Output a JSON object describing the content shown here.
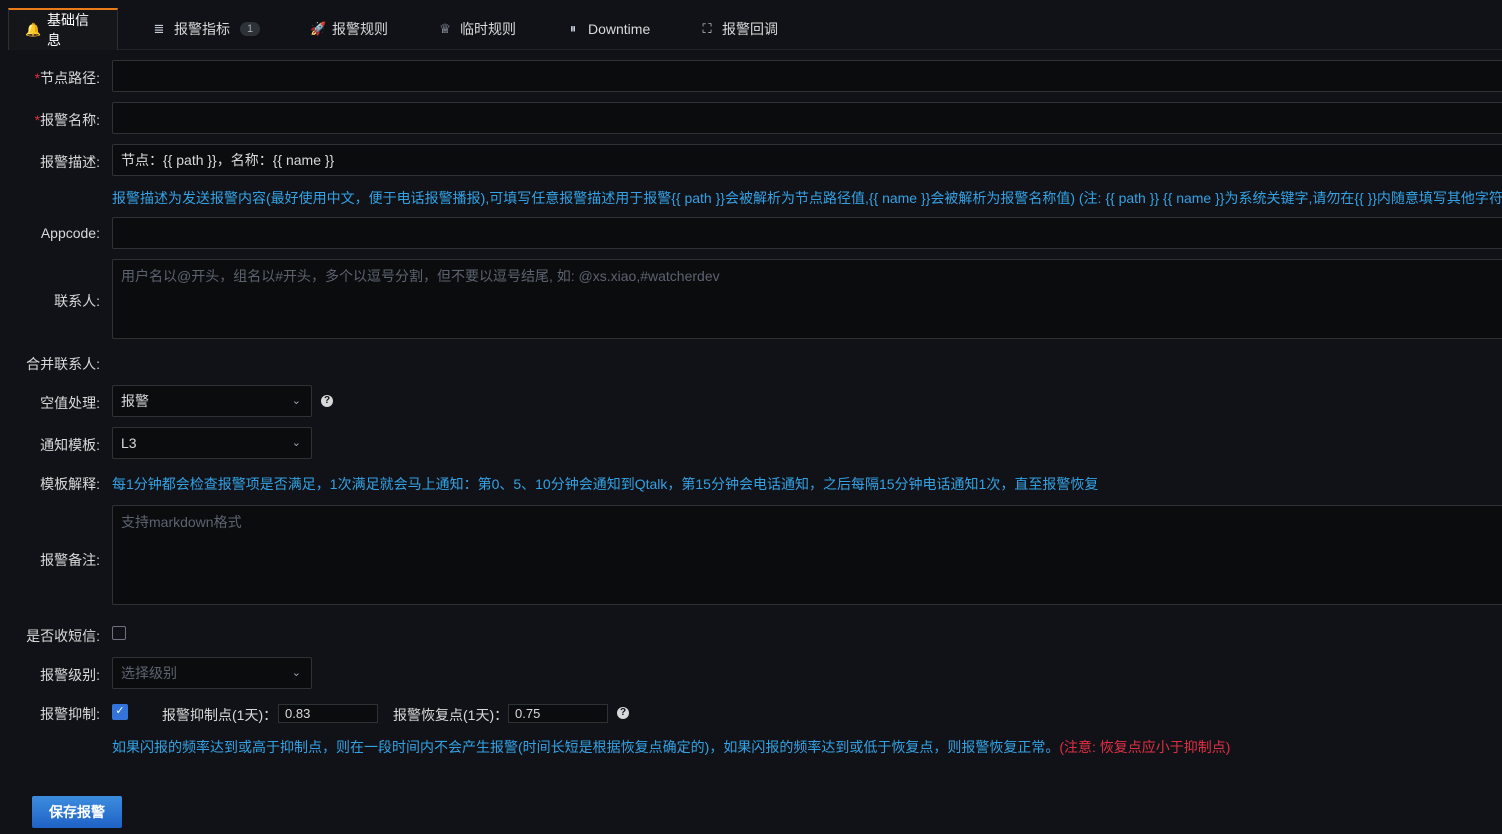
{
  "tabs": [
    {
      "label": "基础信息",
      "icon": "bell-icon",
      "glyph": "🔔"
    },
    {
      "label": "报警指标",
      "icon": "database-icon",
      "glyph": "≣",
      "badge": "1"
    },
    {
      "label": "报警规则",
      "icon": "rocket-icon",
      "glyph": "🚀"
    },
    {
      "label": "临时规则",
      "icon": "bulb-icon",
      "glyph": "♕"
    },
    {
      "label": "Downtime",
      "icon": "pause-icon",
      "glyph": "⏸"
    },
    {
      "label": "报警回调",
      "icon": "expand-icon",
      "glyph": "⛶"
    }
  ],
  "form": {
    "required_mark": "*",
    "node_path": {
      "label": "节点路径:",
      "value": ""
    },
    "alert_name": {
      "label": "报警名称:",
      "value": ""
    },
    "alert_desc": {
      "label": "报警描述:",
      "value": "节点：{{ path }}，名称：{{ name }}"
    },
    "desc_hint": "报警描述为发送报警内容(最好使用中文，便于电话报警播报),可填写任意报警描述用于报警{{ path }}会被解析为节点路径值,{{ name }}会被解析为报警名称值) (注: {{ path }} {{ name }}为系统关键字,请勿在{{ }}内随意填写其他字符)",
    "appcode": {
      "label": "Appcode:",
      "value": ""
    },
    "contacts": {
      "label": "联系人:",
      "placeholder": "用户名以@开头，组名以#开头，多个以逗号分割，但不要以逗号结尾, 如: @xs.xiao,#watcherdev"
    },
    "merge_contacts": {
      "label": "合并联系人:"
    },
    "null_handling": {
      "label": "空值处理:",
      "value": "报警"
    },
    "notify_template": {
      "label": "通知模板:",
      "value": "L3"
    },
    "template_explain": {
      "label": "模板解释:",
      "text": "每1分钟都会检查报警项是否满足，1次满足就会马上通知：第0、5、10分钟会通知到Qtalk，第15分钟会电话通知，之后每隔15分钟电话通知1次，直至报警恢复"
    },
    "alert_note": {
      "label": "报警备注:",
      "placeholder": "支持markdown格式"
    },
    "sms": {
      "label": "是否收短信:",
      "checked": false
    },
    "alert_level": {
      "label": "报警级别:",
      "placeholder": "选择级别"
    },
    "suppress": {
      "label": "报警抑制:",
      "checked": true,
      "suppress_point_label": "报警抑制点(1天)：",
      "suppress_point_value": "0.83",
      "recover_point_label": "报警恢复点(1天)：",
      "recover_point_value": "0.75",
      "hint": "如果闪报的频率达到或高于抑制点，则在一段时间内不会产生报警(时间长短是根据恢复点确定的)，如果闪报的频率达到或低于恢复点，则报警恢复正常。",
      "warning": "(注意: 恢复点应小于抑制点)"
    },
    "save_button": "保存报警"
  },
  "colors": {
    "background": "#111217",
    "accent": "#eb7b18",
    "hint_blue": "#33a2e5",
    "warning_red": "#e02f44",
    "button_blue": "#1f62c6"
  }
}
